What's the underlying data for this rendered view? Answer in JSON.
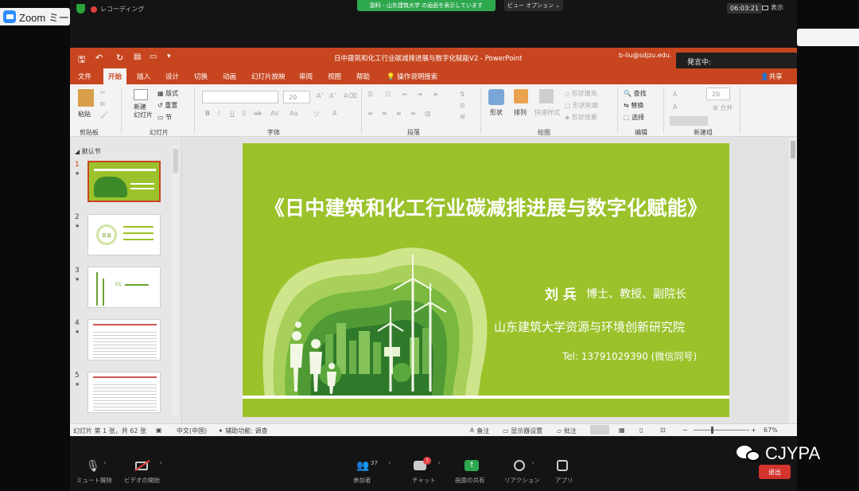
{
  "zoom": {
    "app_tab": "Zoom ミー",
    "recording": "レコーディング",
    "share_banner": "副科 - 山东建筑大学 の画面を表示しています",
    "view_options": "ビュー オプション",
    "time": "06:03:21",
    "display": "表示",
    "speaking": "発言中:",
    "toolbar": [
      {
        "label": "ミュート解除",
        "icon": "microphone-muted-icon"
      },
      {
        "label": "ビデオの開始",
        "icon": "video-off-icon"
      },
      {
        "label": "参加者",
        "icon": "participants-icon",
        "count": "37"
      },
      {
        "label": "チャット",
        "icon": "chat-icon",
        "badge": "7"
      },
      {
        "label": "画面の共有",
        "icon": "share-screen-icon"
      },
      {
        "label": "リアクション",
        "icon": "reaction-icon"
      },
      {
        "label": "アプリ",
        "icon": "apps-icon"
      }
    ],
    "leave": "退出"
  },
  "ppt": {
    "doc_title": "日中建筑和化工行业碳减排进展与数字化赋能V2  -  PowerPoint",
    "account": "b-liu@sdjzu.edu.",
    "tabs": [
      "文件",
      "开始",
      "插入",
      "设计",
      "切换",
      "动画",
      "幻灯片放映",
      "审阅",
      "视图",
      "帮助",
      "操作说明搜索"
    ],
    "active_tab": "开始",
    "share": "共享",
    "ribbon": {
      "paste": "粘贴",
      "new_slide": "新建\n幻灯片",
      "layout": "版式",
      "reset": "重置",
      "section": "节",
      "font_size": "20",
      "shape": "形状",
      "arrange": "排列",
      "quick_styles": "快速样式",
      "shape_fill": "形状填充",
      "shape_outline": "形状轮廓",
      "shape_effects": "形状效果",
      "find": "查找",
      "replace": "替换",
      "select": "选择",
      "ng_size": "20",
      "merge": "合并",
      "groups": [
        "剪贴板",
        "幻灯片",
        "字体",
        "段落",
        "绘图",
        "编辑",
        "新建组"
      ]
    },
    "section_name": "默认节",
    "thumbnails": [
      {
        "num": "1"
      },
      {
        "num": "2"
      },
      {
        "num": "3"
      },
      {
        "num": "4"
      },
      {
        "num": "5"
      }
    ],
    "thumb2_text": "目录",
    "thumb3_text": "01",
    "slide": {
      "title": "《日中建筑和化工行业碳减排进展与数字化赋能》",
      "name": "刘 兵",
      "role": "博士、教授、副院长",
      "institution": "山东建筑大学资源与环境创新研究院",
      "tel": "Tel: 13791029390   (微信同号)"
    },
    "status": {
      "slide_count": "幻灯片 第 1 张，共 62 张",
      "language": "中文(中国)",
      "accessibility": "辅助功能: 调查",
      "notes": "备注",
      "display_settings": "显示器设置",
      "comments": "批注",
      "zoom": "67%"
    }
  },
  "watermark": "CJYPA",
  "colors": {
    "ppt_accent": "#c7461f",
    "slide_green": "#9bc22b",
    "zoom_share_green": "#2ea84f",
    "leave_red": "#d4332e"
  }
}
